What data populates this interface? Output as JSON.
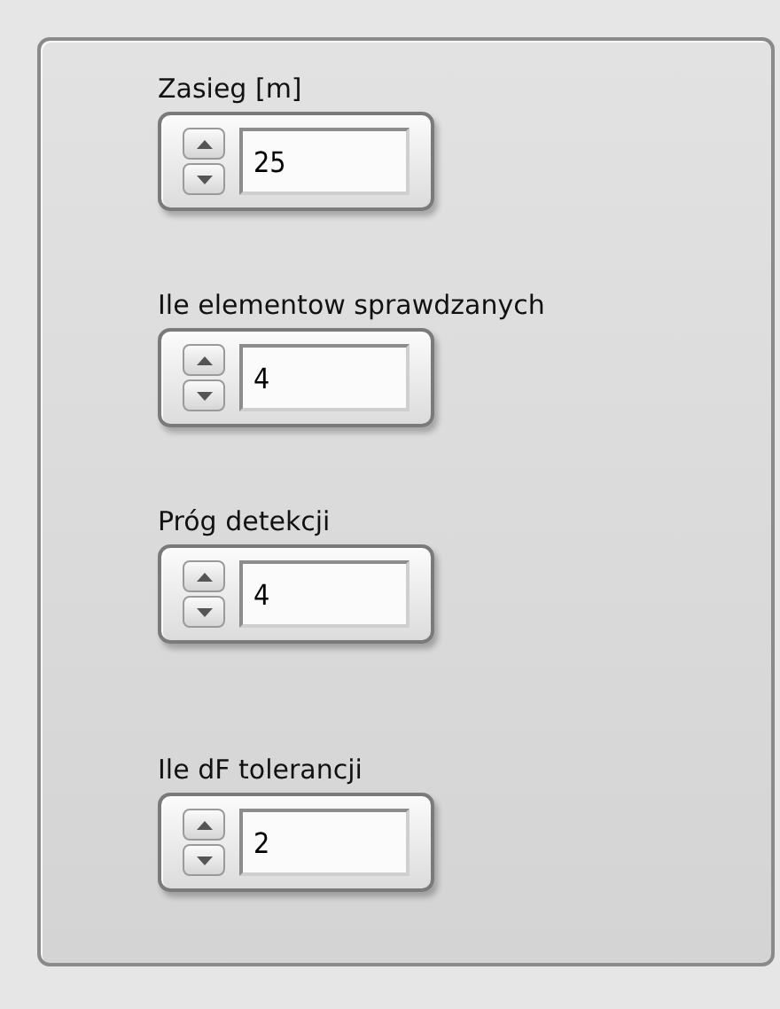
{
  "controls": [
    {
      "label": "Zasieg [m]",
      "value": "25"
    },
    {
      "label": "Ile elementow sprawdzanych",
      "value": "4"
    },
    {
      "label": "Próg detekcji",
      "value": "4"
    },
    {
      "label": "Ile dF tolerancji",
      "value": "2"
    }
  ]
}
